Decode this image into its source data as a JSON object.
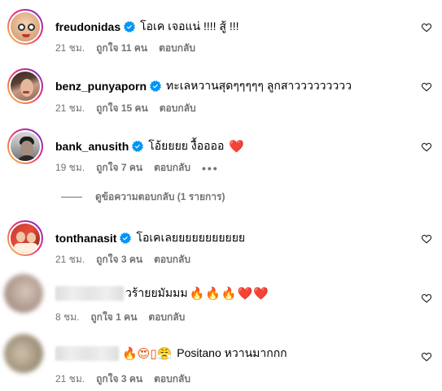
{
  "comments": [
    {
      "username": "freudonidas",
      "verified": true,
      "text": "โอเค เจอแน่ !!!! สู้ !!!",
      "time": "21 ชม.",
      "likes": "ถูกใจ 11 คน",
      "reply": "ตอบกลับ",
      "avatar_icon": "avatar-icon"
    },
    {
      "username": "benz_punyaporn",
      "verified": true,
      "text": "ทะเลหวานสุดๆๆๆๆๆ ลูกสาววววววววว",
      "time": "21 ชม.",
      "likes": "ถูกใจ 15 คน",
      "reply": "ตอบกลับ",
      "avatar_icon": "avatar-icon"
    },
    {
      "username": "bank_anusith",
      "verified": true,
      "text": "โอ้ยยยย งื้ออออ",
      "text_emoji": "❤️",
      "time": "19 ชม.",
      "likes": "ถูกใจ 7 คน",
      "reply": "ตอบกลับ",
      "more": "•••",
      "avatar_icon": "avatar-icon"
    },
    {
      "username": "tonthanasit",
      "verified": true,
      "text": "โอเคเลยยยยยยยยยยย",
      "time": "21 ชม.",
      "likes": "ถูกใจ 3 คน",
      "reply": "ตอบกลับ",
      "avatar_icon": "avatar-icon"
    },
    {
      "username": "",
      "verified": false,
      "text": "วร้ายยมัมมม",
      "text_emoji": "🔥🔥🔥❤️❤️",
      "time": "8 ชม.",
      "likes": "ถูกใจ 1 คน",
      "reply": "ตอบกลับ",
      "avatar_icon": "avatar-icon"
    },
    {
      "username": "",
      "verified": false,
      "text_emoji": "🔥😍▯😤",
      "text": "Positano หวานมากกก",
      "time": "21 ชม.",
      "likes": "ถูกใจ 3 คน",
      "reply": "ตอบกลับ",
      "avatar_icon": "avatar-icon"
    }
  ],
  "view_replies": "ดูข้อความตอบกลับ (1 รายการ)",
  "icons": {
    "verified": "verified-badge-icon",
    "like": "heart-outline-icon"
  },
  "colors": {
    "verified_blue": "#0095f6",
    "meta_gray": "#737373",
    "heart_red": "#e0245e",
    "story_ring_start": "#f9ce34",
    "story_ring_end": "#ee2a7b"
  }
}
